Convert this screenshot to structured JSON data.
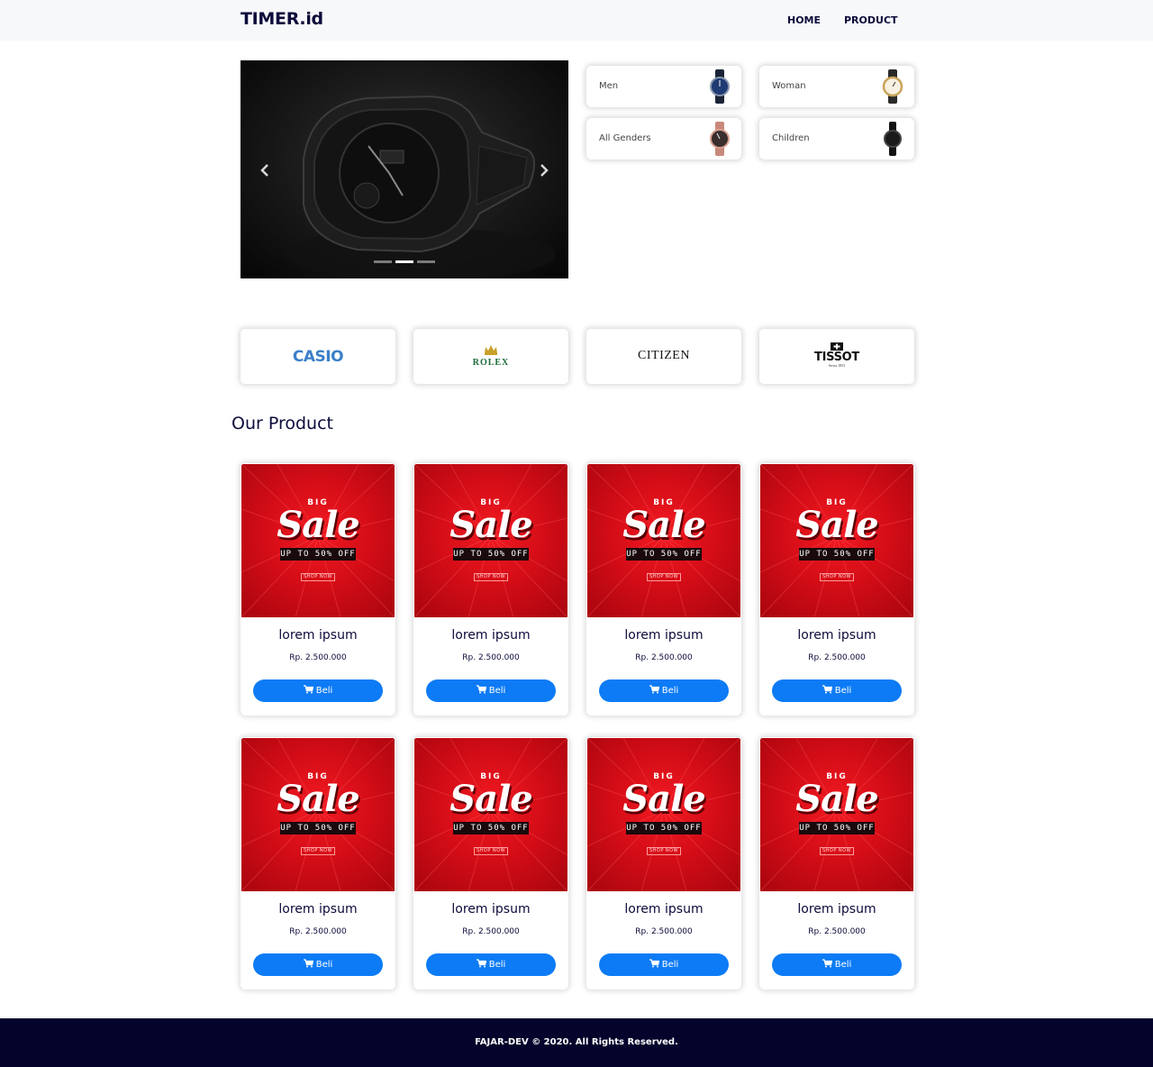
{
  "navbar": {
    "brand": "TIMER.id",
    "links": [
      "HOME",
      "PRODUCT"
    ]
  },
  "carousel": {
    "prev_icon": "chevron-left-icon",
    "next_icon": "chevron-right-icon",
    "slide_count": 3,
    "active_slide": 2
  },
  "categories": [
    {
      "label": "Men",
      "watch_color": "#1f3b73"
    },
    {
      "label": "Woman",
      "watch_color": "#c9a45a"
    },
    {
      "label": "All Genders",
      "watch_color": "#c9897a"
    },
    {
      "label": "Children",
      "watch_color": "#1a1a1a"
    }
  ],
  "brands": [
    {
      "name": "CASIO"
    },
    {
      "name": "ROLEX"
    },
    {
      "name": "CITIZEN"
    },
    {
      "name": "TISSOT",
      "sub": "Swiss 1853"
    }
  ],
  "section_title": "Our Product",
  "product_image": {
    "big": "BIG",
    "sale": "Sale",
    "offer": "UP TO 50% OFF",
    "shop": "SHOP NOW"
  },
  "products": [
    {
      "name": "lorem ipsum",
      "price": "Rp. 2.500.000",
      "button": "Beli"
    },
    {
      "name": "lorem ipsum",
      "price": "Rp. 2.500.000",
      "button": "Beli"
    },
    {
      "name": "lorem ipsum",
      "price": "Rp. 2.500.000",
      "button": "Beli"
    },
    {
      "name": "lorem ipsum",
      "price": "Rp. 2.500.000",
      "button": "Beli"
    },
    {
      "name": "lorem ipsum",
      "price": "Rp. 2.500.000",
      "button": "Beli"
    },
    {
      "name": "lorem ipsum",
      "price": "Rp. 2.500.000",
      "button": "Beli"
    },
    {
      "name": "lorem ipsum",
      "price": "Rp. 2.500.000",
      "button": "Beli"
    },
    {
      "name": "lorem ipsum",
      "price": "Rp. 2.500.000",
      "button": "Beli"
    }
  ],
  "footer": {
    "text": "FAJAR-DEV © 2020. All Rights Reserved."
  },
  "colors": {
    "accent": "#0d7bf5",
    "navy": "#03032b",
    "sale_red": "#d50d17"
  }
}
